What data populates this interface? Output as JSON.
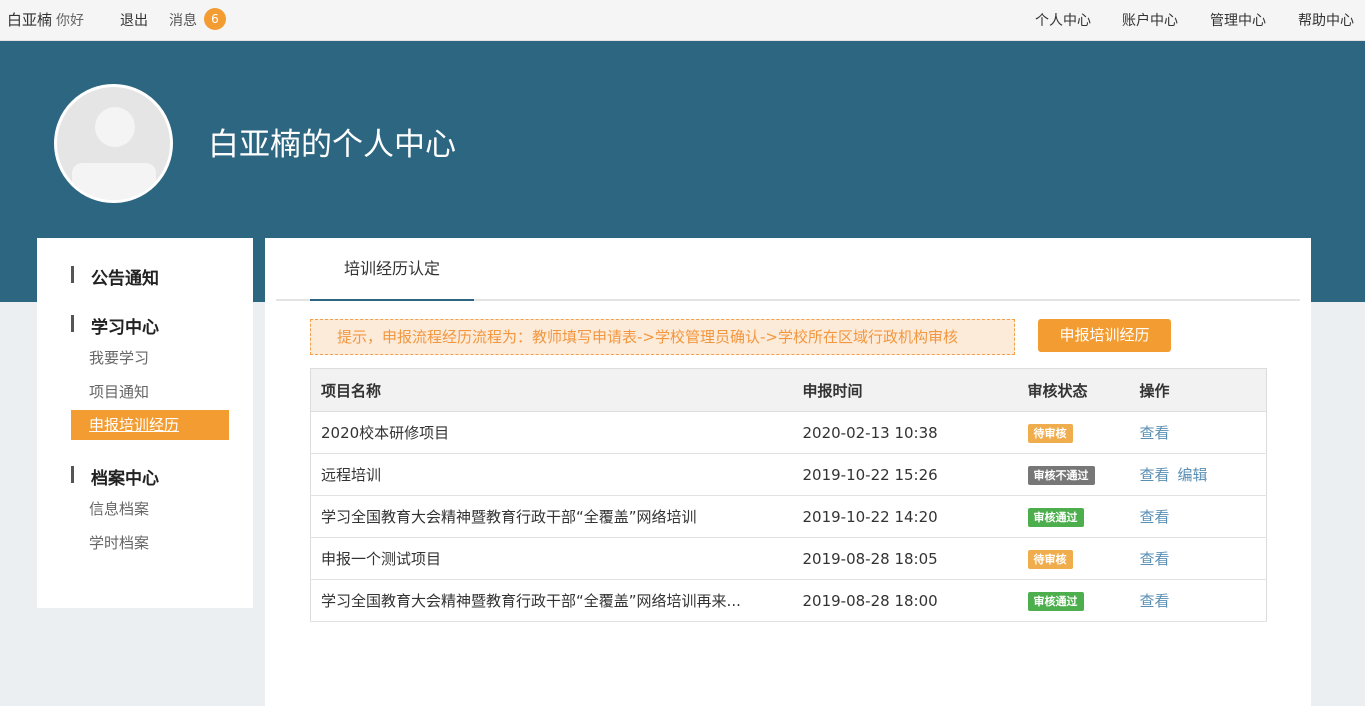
{
  "topbar": {
    "user_name": "白亚楠",
    "greeting": "你好",
    "logout": "退出",
    "messages": "消息",
    "message_count": "6",
    "links": [
      "个人中心",
      "账户中心",
      "管理中心",
      "帮助中心"
    ]
  },
  "banner": {
    "title": "白亚楠的个人中心"
  },
  "sidebar": {
    "sections": [
      {
        "heading": "公告通知",
        "items": []
      },
      {
        "heading": "学习中心",
        "items": [
          "我要学习",
          "项目通知",
          "申报培训经历"
        ]
      },
      {
        "heading": "档案中心",
        "items": [
          "信息档案",
          "学时档案"
        ]
      }
    ],
    "active_item": "申报培训经历"
  },
  "main": {
    "tab": "培训经历认定",
    "notice": "提示，申报流程经历流程为：教师填写申请表->学校管理员确认->学校所在区域行政机构审核",
    "apply_button": "申报培训经历",
    "table": {
      "headers": [
        "项目名称",
        "申报时间",
        "审核状态",
        "操作"
      ],
      "rows": [
        {
          "name": "2020校本研修项目",
          "time": "2020-02-13 10:38",
          "status": "待审核",
          "ops": [
            "查看"
          ]
        },
        {
          "name": "远程培训",
          "time": "2019-10-22 15:26",
          "status": "审核不通过",
          "ops": [
            "查看",
            "编辑"
          ]
        },
        {
          "name": "学习全国教育大会精神暨教育行政干部“全覆盖”网络培训",
          "time": "2019-10-22 14:20",
          "status": "审核通过",
          "ops": [
            "查看"
          ]
        },
        {
          "name": "申报一个测试项目",
          "time": "2019-08-28 18:05",
          "status": "待审核",
          "ops": [
            "查看"
          ]
        },
        {
          "name": "学习全国教育大会精神暨教育行政干部“全覆盖”网络培训再来...",
          "time": "2019-08-28 18:00",
          "status": "审核通过",
          "ops": [
            "查看"
          ]
        }
      ]
    },
    "status_colors": {
      "待审核": "#f0ad4e",
      "审核不通过": "#777777",
      "审核通过": "#4cae4c"
    }
  }
}
